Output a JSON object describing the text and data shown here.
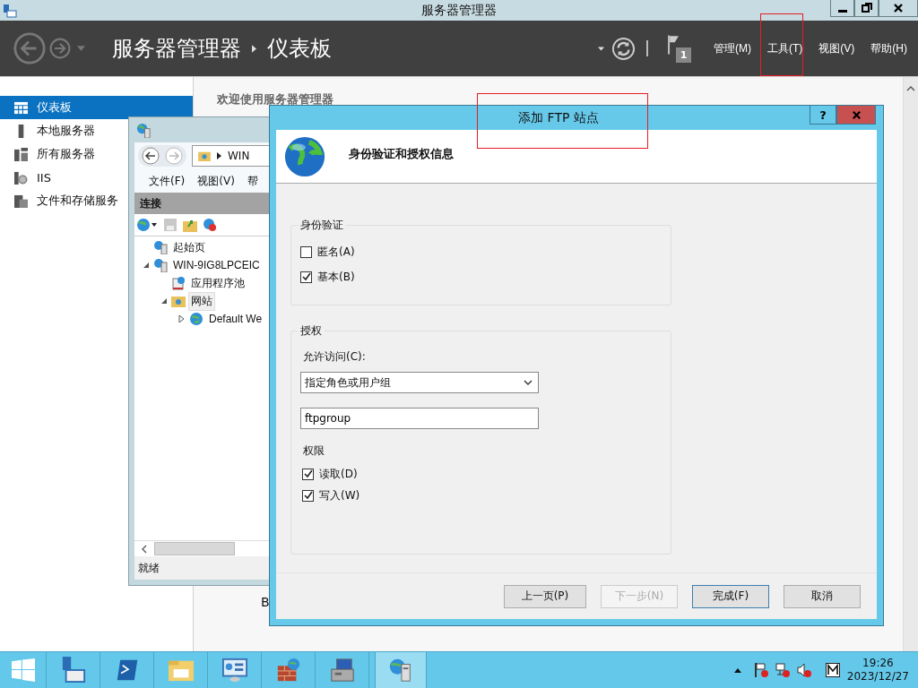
{
  "window": {
    "title": "服务器管理器"
  },
  "header": {
    "breadcrumb": [
      "服务器管理器",
      "仪表板"
    ],
    "flag_count": "1",
    "menus": [
      "管理(M)",
      "工具(T)",
      "视图(V)",
      "帮助(H)"
    ]
  },
  "sidebar": {
    "items": [
      {
        "label": "仪表板",
        "selected": true
      },
      {
        "label": "本地服务器",
        "selected": false
      },
      {
        "label": "所有服务器",
        "selected": false
      },
      {
        "label": "IIS",
        "selected": false
      },
      {
        "label": "文件和存储服务",
        "selected": false
      }
    ]
  },
  "main": {
    "welcome": "欢迎使用服务器管理器",
    "fragment": "B"
  },
  "iis_window": {
    "address": "WIN",
    "menus": [
      "文件(F)",
      "视图(V)",
      "帮"
    ],
    "panel_title": "连接",
    "tree": [
      {
        "label": "起始页",
        "selected": false
      },
      {
        "label": "WIN-9IG8LPCEIC",
        "selected": false,
        "expanded": true,
        "children": [
          {
            "label": "应用程序池",
            "selected": false
          },
          {
            "label": "网站",
            "selected": true,
            "expanded": true,
            "children": [
              {
                "label": "Default We",
                "selected": false,
                "expanded": false
              }
            ]
          }
        ]
      }
    ],
    "status": "就绪"
  },
  "dialog": {
    "title": "添加 FTP 站点",
    "help": "?",
    "heading": "身份验证和授权信息",
    "authentication": {
      "title": "身份验证",
      "options": [
        {
          "label": "匿名(A)",
          "checked": false
        },
        {
          "label": "基本(B)",
          "checked": true
        }
      ]
    },
    "authorization": {
      "title": "授权",
      "access_label": "允许访问(C):",
      "access_value": "指定角色或用户组",
      "users_value": "ftpgroup",
      "permissions_label": "权限",
      "permissions": [
        {
          "label": "读取(D)",
          "checked": true
        },
        {
          "label": "写入(W)",
          "checked": true
        }
      ]
    },
    "buttons": [
      {
        "label": "上一页(P)",
        "disabled": false,
        "default": false
      },
      {
        "label": "下一步(N)",
        "disabled": true,
        "default": false
      },
      {
        "label": "完成(F)",
        "disabled": false,
        "default": true
      },
      {
        "label": "取消",
        "disabled": false,
        "default": false
      }
    ]
  },
  "taskbar": {
    "apps": [
      {
        "selected": false
      },
      {
        "selected": false
      },
      {
        "selected": false
      },
      {
        "selected": false
      },
      {
        "selected": false
      },
      {
        "selected": false
      },
      {
        "selected": true
      }
    ],
    "time": "19:26",
    "date": "2023/12/27"
  }
}
